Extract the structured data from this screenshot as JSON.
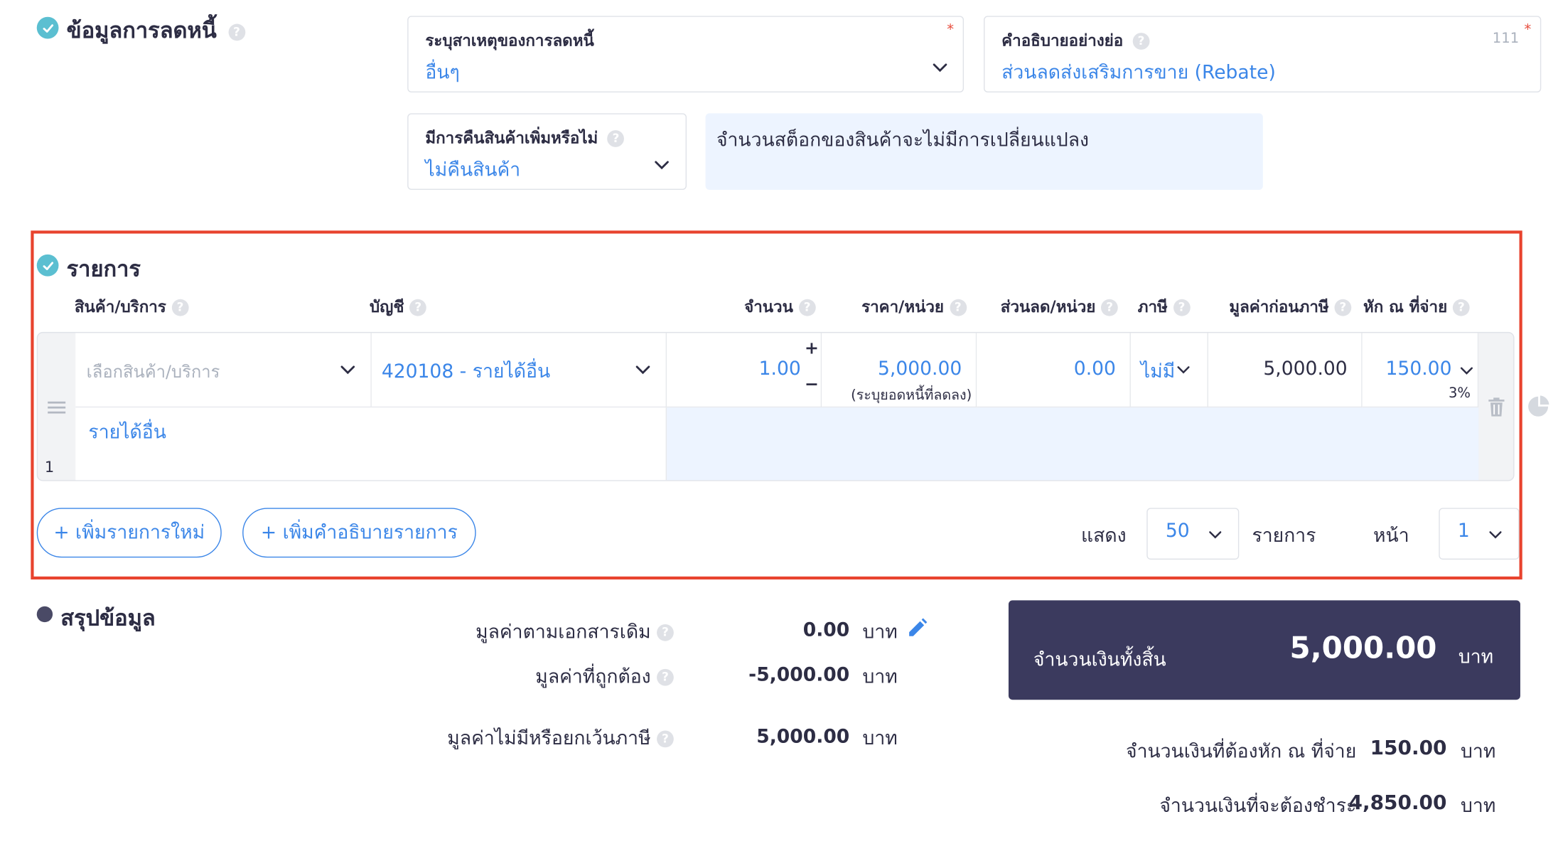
{
  "debt_info": {
    "title": "ข้อมูลการลดหนี้",
    "reason_label": "ระบุสาเหตุของการลดหนี้",
    "reason_value": "อื่นๆ",
    "required_mark": "*",
    "short_desc_label": "คำอธิบายอย่างย่อ",
    "short_desc_value": "ส่วนลดส่งเสริมการขาย (Rebate)",
    "short_desc_counter": "111",
    "return_label": "มีการคืนสินค้าเพิ่มหรือไม่",
    "return_value": "ไม่คืนสินค้า",
    "stock_note": "จำนวนสต็อกของสินค้าจะไม่มีการเปลี่ยนแปลง"
  },
  "items": {
    "title": "รายการ",
    "columns": {
      "product": "สินค้า/บริการ",
      "account": "บัญชี",
      "quantity": "จำนวน",
      "price": "ราคา/หน่วย",
      "discount": "ส่วนลด/หน่วย",
      "vat": "ภาษี",
      "pre_tax": "มูลค่าก่อนภาษี",
      "withholding": "หัก ณ ที่จ่าย"
    },
    "row": {
      "index": "1",
      "product_placeholder": "เลือกสินค้า/บริการ",
      "account": "420108 - รายได้อื่น",
      "quantity": "1.00",
      "plus": "+",
      "minus": "−",
      "price": "5,000.00",
      "price_note": "(ระบุยอดหนี้ที่ลดลง)",
      "discount": "0.00",
      "vat": "ไม่มี",
      "pre_tax": "5,000.00",
      "withholding": "150.00",
      "withholding_rate": "3%",
      "description": "รายได้อื่น"
    },
    "add_item_button": "+ เพิ่มรายการใหม่",
    "add_desc_button": "+ เพิ่มคำอธิบายรายการ",
    "show_label": "แสดง",
    "per_page": "50",
    "items_label": "รายการ",
    "page_label": "หน้า",
    "page": "1"
  },
  "summary": {
    "title": "สรุปข้อมูล",
    "original_label": "มูลค่าตามเอกสารเดิม",
    "original_value": "0.00",
    "correct_label": "มูลค่าที่ถูกต้อง",
    "correct_value": "-5,000.00",
    "exempt_label": "มูลค่าไม่มีหรือยกเว้นภาษี",
    "exempt_value": "5,000.00",
    "unit": "บาท",
    "total_label": "จำนวนเงินทั้งสิ้น",
    "total_value": "5,000.00",
    "withholding_label": "จำนวนเงินที่ต้องหัก ณ ที่จ่าย",
    "withholding_value": "150.00",
    "payable_label": "จำนวนเงินที่จะต้องชำระ",
    "payable_value": "4,850.00"
  },
  "colors": {
    "accent": "#3b86e8",
    "check": "#5bbfd1",
    "highlight_border": "#e8432e",
    "total_panel": "#3b3a5e",
    "note_bg": "#edf4ff"
  }
}
